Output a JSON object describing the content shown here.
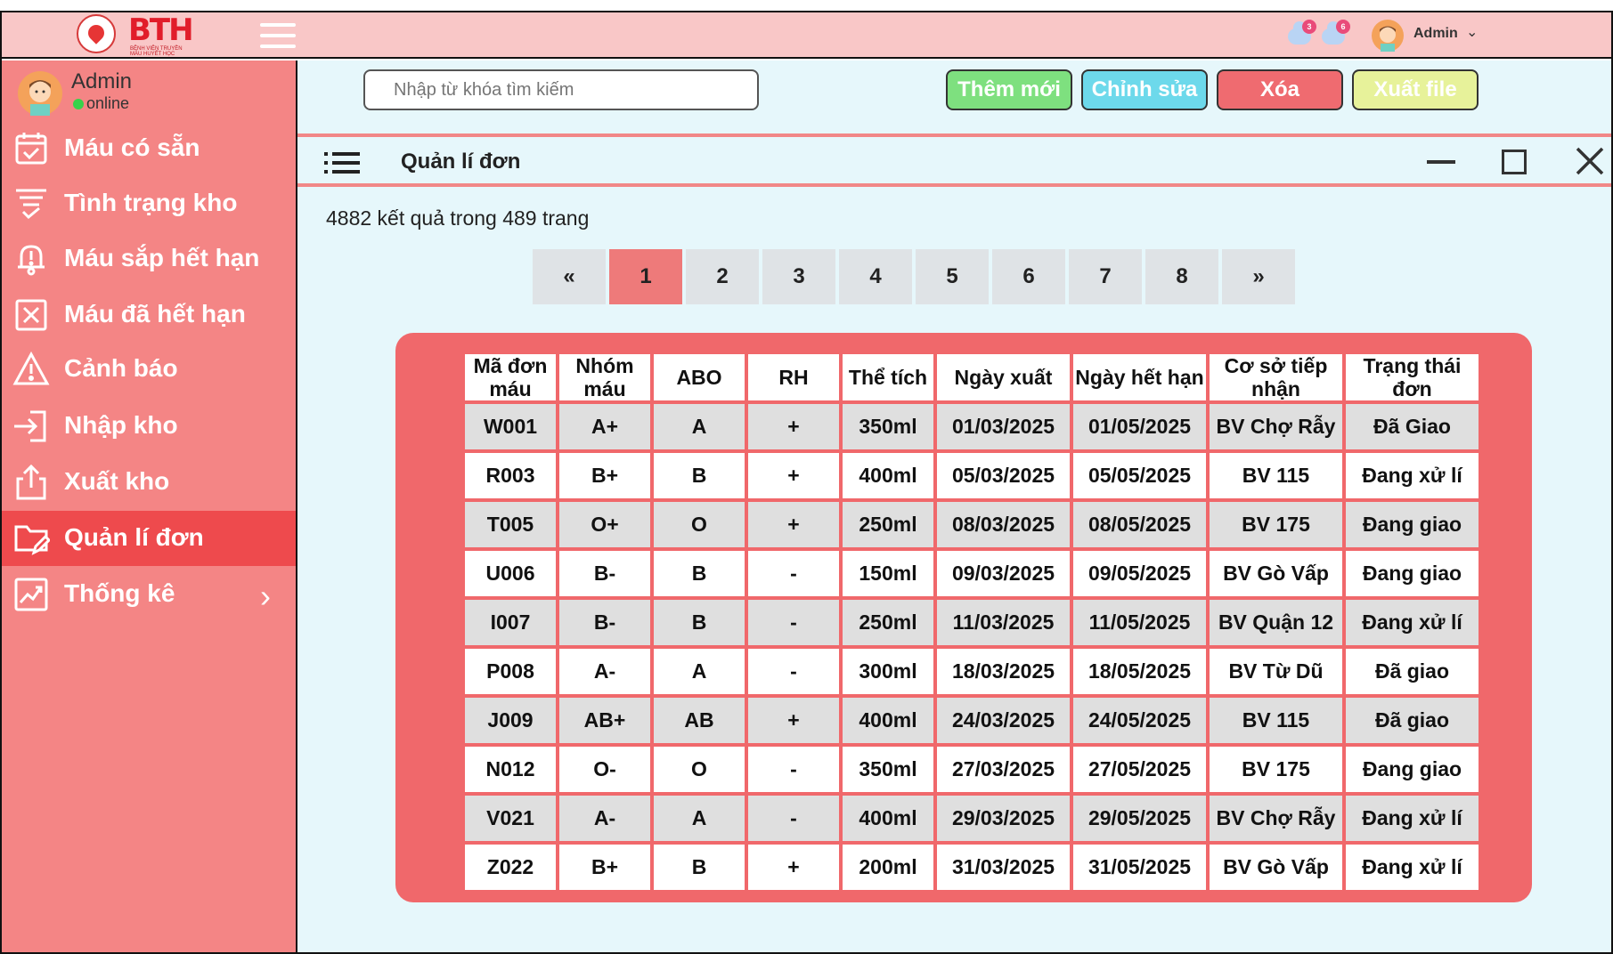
{
  "app": {
    "logo_text": "BTH",
    "logo_subtitle": "BỆNH VIỆN TRUYỀN MÁU HUYẾT HỌC"
  },
  "topbar": {
    "notifications": [
      {
        "icon": "cloud-notification-icon",
        "count": "3"
      },
      {
        "icon": "cloud-notification-icon",
        "count": "6"
      }
    ],
    "user_name": "Admin",
    "chevron": "⌄"
  },
  "sidebar": {
    "user_name": "Admin",
    "status": "online",
    "items": [
      {
        "label": "Máu có sẵn",
        "icon": "calendar-check-icon"
      },
      {
        "label": "Tình trạng kho",
        "icon": "filter-check-icon"
      },
      {
        "label": "Máu sắp hết hạn",
        "icon": "bell-alert-icon"
      },
      {
        "label": "Máu đã hết hạn",
        "icon": "x-square-icon"
      },
      {
        "label": "Cảnh báo",
        "icon": "warning-icon"
      },
      {
        "label": "Nhập kho",
        "icon": "import-icon"
      },
      {
        "label": "Xuất kho",
        "icon": "export-icon"
      },
      {
        "label": "Quản lí đơn",
        "icon": "folder-edit-icon",
        "active": true
      },
      {
        "label": "Thống kê",
        "icon": "chart-icon",
        "arrow": "›"
      }
    ]
  },
  "toolbar": {
    "search_placeholder": "Nhập từ khóa tìm kiếm",
    "add_label": "Thêm mới",
    "edit_label": "Chỉnh sửa",
    "delete_label": "Xóa",
    "export_label": "Xuất file"
  },
  "panel": {
    "title": "Quản lí đơn",
    "result_info": "4882 kết quả trong 489 trang"
  },
  "pagination": {
    "first": "«",
    "pages": [
      "1",
      "2",
      "3",
      "4",
      "5",
      "6",
      "7",
      "8"
    ],
    "last": "»",
    "current": "1"
  },
  "table": {
    "headers": [
      "Mã đơn máu",
      "Nhóm máu",
      "ABO",
      "RH",
      "Thể tích",
      "Ngày xuất",
      "Ngày hết hạn",
      "Cơ sở tiếp nhận",
      "Trạng thái đơn"
    ],
    "rows": [
      [
        "W001",
        "A+",
        "A",
        "+",
        "350ml",
        "01/03/2025",
        "01/05/2025",
        "BV Chợ Rẫy",
        "Đã Giao"
      ],
      [
        "R003",
        "B+",
        "B",
        "+",
        "400ml",
        "05/03/2025",
        "05/05/2025",
        "BV 115",
        "Đang xử lí"
      ],
      [
        "T005",
        "O+",
        "O",
        "+",
        "250ml",
        "08/03/2025",
        "08/05/2025",
        "BV 175",
        "Đang giao"
      ],
      [
        "U006",
        "B-",
        "B",
        "-",
        "150ml",
        "09/03/2025",
        "09/05/2025",
        "BV Gò Vấp",
        "Đang giao"
      ],
      [
        "I007",
        "B-",
        "B",
        "-",
        "250ml",
        "11/03/2025",
        "11/05/2025",
        "BV Quận 12",
        "Đang xử lí"
      ],
      [
        "P008",
        "A-",
        "A",
        "-",
        "300ml",
        "18/03/2025",
        "18/05/2025",
        "BV Từ Dũ",
        "Đã giao"
      ],
      [
        "J009",
        "AB+",
        "AB",
        "+",
        "400ml",
        "24/03/2025",
        "24/05/2025",
        "BV 115",
        "Đã giao"
      ],
      [
        "N012",
        "O-",
        "O",
        "-",
        "350ml",
        "27/03/2025",
        "27/05/2025",
        "BV 175",
        "Đang giao"
      ],
      [
        "V021",
        "A-",
        "A",
        "-",
        "400ml",
        "29/03/2025",
        "29/05/2025",
        "BV Chợ Rẫy",
        "Đang xử lí"
      ],
      [
        "Z022",
        "B+",
        "B",
        "+",
        "200ml",
        "31/03/2025",
        "31/05/2025",
        "BV Gò Vấp",
        "Đang xử lí"
      ]
    ]
  },
  "colors": {
    "topbar": "#f9c7c7",
    "sidebar": "#f48585",
    "sidebar_active": "#ee4a4d",
    "content_bg": "#e6f7fb",
    "table_card": "#f0686b",
    "btn_add": "#7ee07f",
    "btn_edit": "#6dd9eb",
    "btn_delete": "#ef6b70",
    "btn_export": "#e7f29a"
  }
}
